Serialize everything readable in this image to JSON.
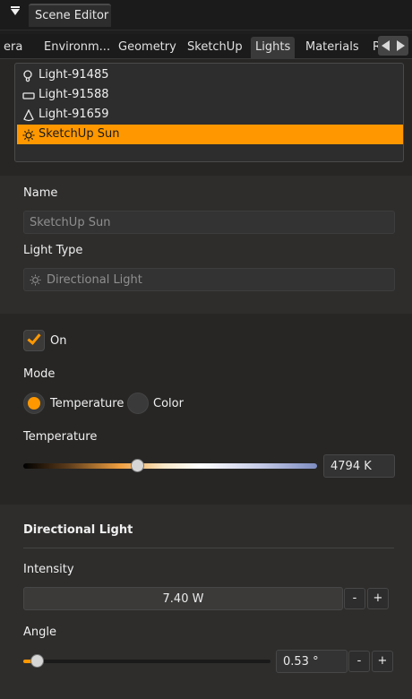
{
  "window": {
    "title": "Scene Editor"
  },
  "tabs": [
    {
      "label": "era"
    },
    {
      "label": "Environm..."
    },
    {
      "label": "Geometry"
    },
    {
      "label": "SketchUp"
    },
    {
      "label": "Lights",
      "active": true
    },
    {
      "label": "Materials"
    },
    {
      "label": "R"
    }
  ],
  "lights": [
    {
      "name": "Light-91485",
      "icon": "bulb-icon"
    },
    {
      "name": "Light-91588",
      "icon": "rect-light-icon"
    },
    {
      "name": "Light-91659",
      "icon": "cone-light-icon"
    },
    {
      "name": "SketchUp Sun",
      "icon": "sun-icon",
      "selected": true
    }
  ],
  "properties": {
    "name_label": "Name",
    "name_value": "SketchUp Sun",
    "type_label": "Light Type",
    "type_value": "Directional Light",
    "on_label": "On",
    "on_checked": true,
    "mode_label": "Mode",
    "mode_temperature": "Temperature",
    "mode_color": "Color",
    "mode_selected": "Temperature",
    "temperature_label": "Temperature",
    "temperature_value": "4794 K",
    "temperature_fraction": 0.39
  },
  "directional": {
    "heading": "Directional Light",
    "intensity_label": "Intensity",
    "intensity_value": "7.40 W",
    "angle_label": "Angle",
    "angle_value": "0.53 °",
    "angle_fraction": 0.03,
    "minus": "-",
    "plus": "+"
  },
  "colors": {
    "accent": "#ff9800",
    "panel": "#272625",
    "section": "#2e2d2c"
  }
}
